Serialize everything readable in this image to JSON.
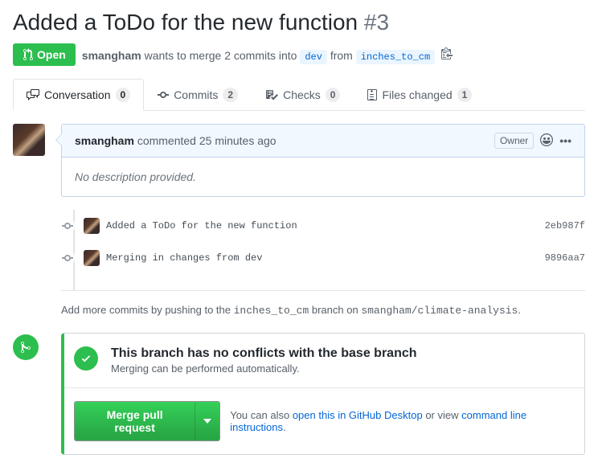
{
  "header": {
    "title": "Added a ToDo for the new function",
    "issue_number": "#3",
    "state_label": "Open",
    "author": "smangham",
    "merge_line_part1": "wants to merge 2 commits into",
    "base_ref": "dev",
    "merge_line_part2": "from",
    "head_ref": "inches_to_cm"
  },
  "tabs": {
    "conversation": {
      "label": "Conversation",
      "count": "0"
    },
    "commits": {
      "label": "Commits",
      "count": "2"
    },
    "checks": {
      "label": "Checks",
      "count": "0"
    },
    "files": {
      "label": "Files changed",
      "count": "1"
    }
  },
  "comment": {
    "author": "smangham",
    "action": "commented",
    "time": "25 minutes ago",
    "owner_label": "Owner",
    "body": "No description provided."
  },
  "commits": [
    {
      "message": "Added a ToDo for the new function",
      "sha": "2eb987f"
    },
    {
      "message": "Merging in changes from dev",
      "sha": "9896aa7"
    }
  ],
  "push_hint": {
    "prefix": "Add more commits by pushing to the",
    "branch": "inches_to_cm",
    "middle": "branch on",
    "repo": "smangham/climate-analysis",
    "suffix": "."
  },
  "merge": {
    "title": "This branch has no conflicts with the base branch",
    "subtitle": "Merging can be performed automatically.",
    "button": "Merge pull request",
    "hint_prefix": "You can also",
    "link_desktop": "open this in GitHub Desktop",
    "hint_mid": "or view",
    "link_cli": "command line instructions",
    "hint_suffix": "."
  }
}
